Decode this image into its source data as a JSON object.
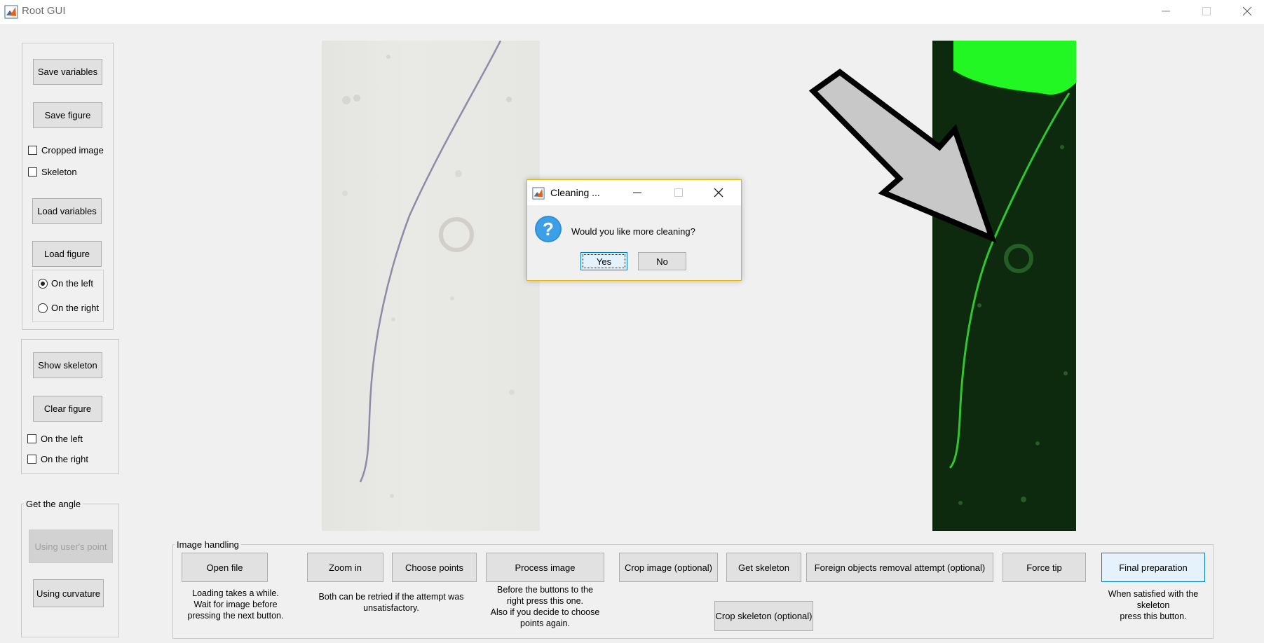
{
  "window": {
    "title": "Root GUI",
    "minimize_icon": "minimize-icon",
    "maximize_icon": "maximize-icon",
    "close_icon": "close-icon"
  },
  "left_panel": {
    "save_variables": "Save variables",
    "save_figure": "Save figure",
    "cropped_image": "Cropped image",
    "skeleton": "Skeleton",
    "load_variables": "Load variables",
    "load_figure": "Load figure",
    "on_the_left": "On the left",
    "on_the_right": "On the right"
  },
  "skeleton_panel": {
    "show_skeleton": "Show skeleton",
    "clear_figure": "Clear figure",
    "on_the_left": "On the left",
    "on_the_right": "On the right"
  },
  "angle_panel": {
    "title": "Get the angle",
    "using_users_point": "Using user's point",
    "using_curvature": "Using curvature"
  },
  "image_handling": {
    "title": "Image handling",
    "open_file": "Open file",
    "open_file_caption": "Loading takes a while.\nWait for  image before\npressing the next button.",
    "zoom_in": "Zoom in",
    "choose_points": "Choose points",
    "retry_caption": "Both can be retried if the attempt was\nunsatisfactory.",
    "process_image": "Process image",
    "process_caption": "Before the buttons to the\nright press this one.\nAlso if you decide to choose\npoints again.",
    "crop_image": "Crop image (optional)",
    "get_skeleton": "Get skeleton",
    "foreign_objects": "Foreign objects removal attempt (optional)",
    "force_tip": "Force tip",
    "final_preparation": "Final preparation",
    "final_caption": "When satisfied with the\nskeleton\npress this button.",
    "crop_skeleton": "Crop skeleton (optional)"
  },
  "dialog": {
    "title": "Cleaning ...",
    "question": "Would you like more cleaning?",
    "yes": "Yes",
    "no": "No",
    "icon": "question-icon"
  },
  "colors": {
    "accent": "#0078d7",
    "dialog_border": "#e8b600",
    "fluorescence": "#1fe21f"
  }
}
